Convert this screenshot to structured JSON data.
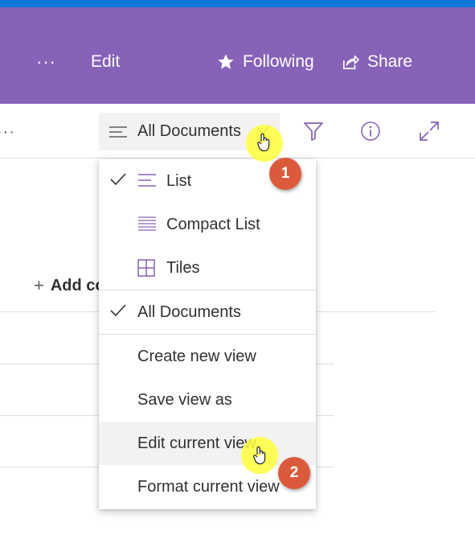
{
  "header": {
    "more_label": "···",
    "edit_label": "Edit",
    "following_label": "Following",
    "share_label": "Share"
  },
  "command_bar": {
    "more_label": "···",
    "view_selector_label": "All Documents",
    "filter_icon": "filter-icon",
    "info_icon": "info-icon",
    "expand_icon": "expand-icon"
  },
  "list": {
    "add_column_label": "Add co"
  },
  "view_menu": {
    "items": [
      {
        "label": "List",
        "icon": "list-icon",
        "checked": true
      },
      {
        "label": "Compact List",
        "icon": "compact-list-icon",
        "checked": false
      },
      {
        "label": "Tiles",
        "icon": "tiles-icon",
        "checked": false
      },
      {
        "label": "All Documents",
        "checked": true
      },
      {
        "label": "Create new view"
      },
      {
        "label": "Save view as"
      },
      {
        "label": "Edit current view",
        "hovered": true
      },
      {
        "label": "Format current view"
      }
    ]
  },
  "callouts": [
    {
      "number": "1"
    },
    {
      "number": "2"
    }
  ],
  "colors": {
    "suite_bar": "#0a78d7",
    "header_purple": "#8662b8",
    "accent": "#8662b8",
    "badge": "#dc5a3c",
    "cursor_highlight": "#ffff3c"
  }
}
